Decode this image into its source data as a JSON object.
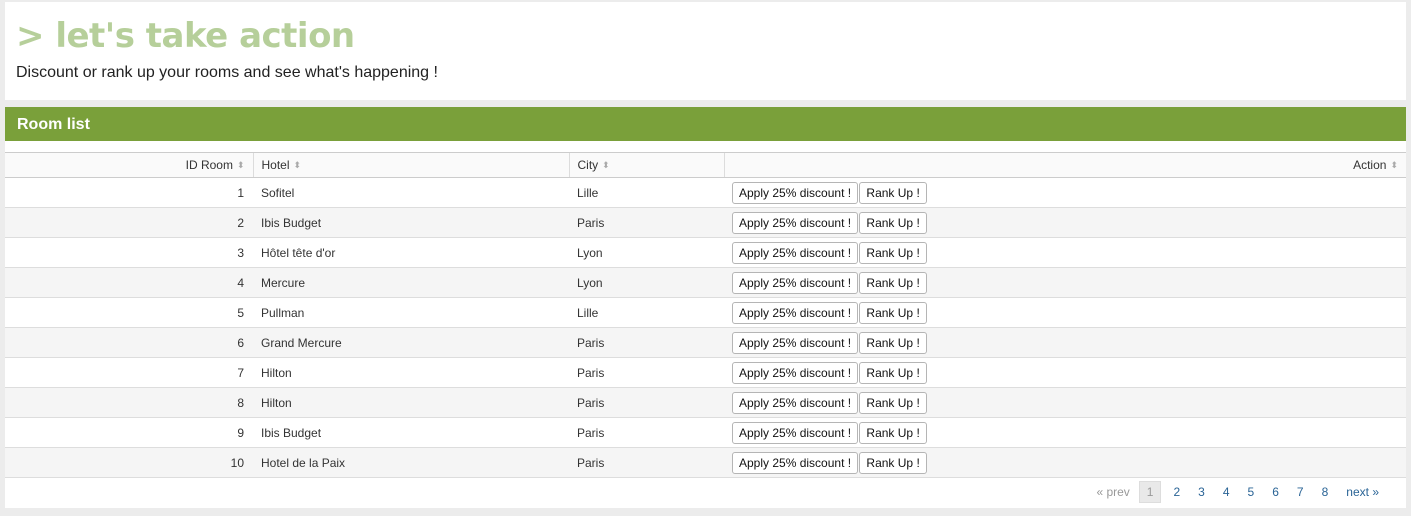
{
  "header": {
    "title": "> let's take action",
    "subtitle": "Discount or rank up your rooms and see what's happening !"
  },
  "panel": {
    "title": "Room list"
  },
  "table": {
    "columns": {
      "id": "ID Room",
      "hotel": "Hotel",
      "city": "City",
      "action": "Action"
    },
    "discount_label": "Apply 25% discount !",
    "rank_label": "Rank Up !",
    "rows": [
      {
        "id": "1",
        "hotel": "Sofitel",
        "city": "Lille"
      },
      {
        "id": "2",
        "hotel": "Ibis Budget",
        "city": "Paris"
      },
      {
        "id": "3",
        "hotel": "Hôtel tête d'or",
        "city": "Lyon"
      },
      {
        "id": "4",
        "hotel": "Mercure",
        "city": "Lyon"
      },
      {
        "id": "5",
        "hotel": "Pullman",
        "city": "Lille"
      },
      {
        "id": "6",
        "hotel": "Grand Mercure",
        "city": "Paris"
      },
      {
        "id": "7",
        "hotel": "Hilton",
        "city": "Paris"
      },
      {
        "id": "8",
        "hotel": "Hilton",
        "city": "Paris"
      },
      {
        "id": "9",
        "hotel": "Ibis Budget",
        "city": "Paris"
      },
      {
        "id": "10",
        "hotel": "Hotel de la Paix",
        "city": "Paris"
      }
    ]
  },
  "pagination": {
    "prev": "« prev",
    "pages": [
      "1",
      "2",
      "3",
      "4",
      "5",
      "6",
      "7",
      "8"
    ],
    "active_page": "1",
    "next": "next »"
  },
  "colors": {
    "accent": "#7aa03a",
    "title": "#b6cf9a",
    "link": "#2a6496"
  }
}
